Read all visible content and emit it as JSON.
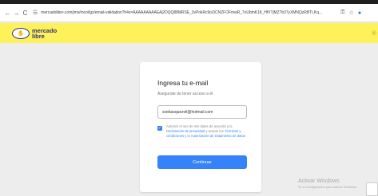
{
  "browser": {
    "back_glyph": "←",
    "forward_glyph": "→",
    "reload_glyph": "C",
    "url": "mercadolibre.com/jms/mco/lgz/email-validation?h4s=AAAAAAAAAEAj2DQQ88MRSE_3vPokRc9oZiCNZFOFmwR_7oUbmK18_HfVTjMZ7b37yXMNQzRBTLKq...",
    "site_settings_icon": "tune-icon",
    "translate_icon": "key-icon",
    "bookmark_icon": "star-icon",
    "profile_icon": "extension-icon"
  },
  "header": {
    "logo_line1": "mercado",
    "logo_line2": "libre",
    "logo_icon": "handshake-icon",
    "brand_color": "#fff159"
  },
  "form": {
    "title": "Ingresa tu e-mail",
    "subtitle": "Asegurate de tener acceso a él.",
    "email_value": "sxebasquezvil@hotmail.com",
    "checked": true,
    "consent_prefix": "Autorizo el uso de mis datos de acuerdo a la",
    "privacy_link": "Declaración de privacidad",
    "consent_mid": "y acepto los",
    "terms_link": "Términos y condiciones",
    "consent_and": "y la",
    "authorization_link": "Autorización de tratamiento de datos",
    "submit_label": "Continuar",
    "accent_color": "#3483fa"
  },
  "watermark": {
    "title": "Activar Windows",
    "subtitle": "Ve a Configuración para activar Windows."
  }
}
